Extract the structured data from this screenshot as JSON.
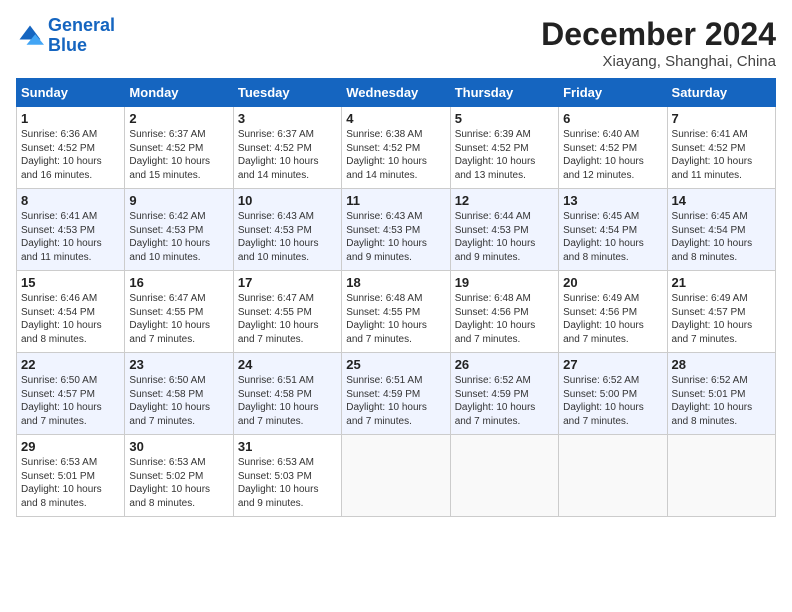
{
  "header": {
    "logo_general": "General",
    "logo_blue": "Blue",
    "month_title": "December 2024",
    "location": "Xiayang, Shanghai, China"
  },
  "weekdays": [
    "Sunday",
    "Monday",
    "Tuesday",
    "Wednesday",
    "Thursday",
    "Friday",
    "Saturday"
  ],
  "weeks": [
    [
      {
        "day": "1",
        "info": "Sunrise: 6:36 AM\nSunset: 4:52 PM\nDaylight: 10 hours\nand 16 minutes."
      },
      {
        "day": "2",
        "info": "Sunrise: 6:37 AM\nSunset: 4:52 PM\nDaylight: 10 hours\nand 15 minutes."
      },
      {
        "day": "3",
        "info": "Sunrise: 6:37 AM\nSunset: 4:52 PM\nDaylight: 10 hours\nand 14 minutes."
      },
      {
        "day": "4",
        "info": "Sunrise: 6:38 AM\nSunset: 4:52 PM\nDaylight: 10 hours\nand 14 minutes."
      },
      {
        "day": "5",
        "info": "Sunrise: 6:39 AM\nSunset: 4:52 PM\nDaylight: 10 hours\nand 13 minutes."
      },
      {
        "day": "6",
        "info": "Sunrise: 6:40 AM\nSunset: 4:52 PM\nDaylight: 10 hours\nand 12 minutes."
      },
      {
        "day": "7",
        "info": "Sunrise: 6:41 AM\nSunset: 4:52 PM\nDaylight: 10 hours\nand 11 minutes."
      }
    ],
    [
      {
        "day": "8",
        "info": "Sunrise: 6:41 AM\nSunset: 4:53 PM\nDaylight: 10 hours\nand 11 minutes."
      },
      {
        "day": "9",
        "info": "Sunrise: 6:42 AM\nSunset: 4:53 PM\nDaylight: 10 hours\nand 10 minutes."
      },
      {
        "day": "10",
        "info": "Sunrise: 6:43 AM\nSunset: 4:53 PM\nDaylight: 10 hours\nand 10 minutes."
      },
      {
        "day": "11",
        "info": "Sunrise: 6:43 AM\nSunset: 4:53 PM\nDaylight: 10 hours\nand 9 minutes."
      },
      {
        "day": "12",
        "info": "Sunrise: 6:44 AM\nSunset: 4:53 PM\nDaylight: 10 hours\nand 9 minutes."
      },
      {
        "day": "13",
        "info": "Sunrise: 6:45 AM\nSunset: 4:54 PM\nDaylight: 10 hours\nand 8 minutes."
      },
      {
        "day": "14",
        "info": "Sunrise: 6:45 AM\nSunset: 4:54 PM\nDaylight: 10 hours\nand 8 minutes."
      }
    ],
    [
      {
        "day": "15",
        "info": "Sunrise: 6:46 AM\nSunset: 4:54 PM\nDaylight: 10 hours\nand 8 minutes."
      },
      {
        "day": "16",
        "info": "Sunrise: 6:47 AM\nSunset: 4:55 PM\nDaylight: 10 hours\nand 7 minutes."
      },
      {
        "day": "17",
        "info": "Sunrise: 6:47 AM\nSunset: 4:55 PM\nDaylight: 10 hours\nand 7 minutes."
      },
      {
        "day": "18",
        "info": "Sunrise: 6:48 AM\nSunset: 4:55 PM\nDaylight: 10 hours\nand 7 minutes."
      },
      {
        "day": "19",
        "info": "Sunrise: 6:48 AM\nSunset: 4:56 PM\nDaylight: 10 hours\nand 7 minutes."
      },
      {
        "day": "20",
        "info": "Sunrise: 6:49 AM\nSunset: 4:56 PM\nDaylight: 10 hours\nand 7 minutes."
      },
      {
        "day": "21",
        "info": "Sunrise: 6:49 AM\nSunset: 4:57 PM\nDaylight: 10 hours\nand 7 minutes."
      }
    ],
    [
      {
        "day": "22",
        "info": "Sunrise: 6:50 AM\nSunset: 4:57 PM\nDaylight: 10 hours\nand 7 minutes."
      },
      {
        "day": "23",
        "info": "Sunrise: 6:50 AM\nSunset: 4:58 PM\nDaylight: 10 hours\nand 7 minutes."
      },
      {
        "day": "24",
        "info": "Sunrise: 6:51 AM\nSunset: 4:58 PM\nDaylight: 10 hours\nand 7 minutes."
      },
      {
        "day": "25",
        "info": "Sunrise: 6:51 AM\nSunset: 4:59 PM\nDaylight: 10 hours\nand 7 minutes."
      },
      {
        "day": "26",
        "info": "Sunrise: 6:52 AM\nSunset: 4:59 PM\nDaylight: 10 hours\nand 7 minutes."
      },
      {
        "day": "27",
        "info": "Sunrise: 6:52 AM\nSunset: 5:00 PM\nDaylight: 10 hours\nand 7 minutes."
      },
      {
        "day": "28",
        "info": "Sunrise: 6:52 AM\nSunset: 5:01 PM\nDaylight: 10 hours\nand 8 minutes."
      }
    ],
    [
      {
        "day": "29",
        "info": "Sunrise: 6:53 AM\nSunset: 5:01 PM\nDaylight: 10 hours\nand 8 minutes."
      },
      {
        "day": "30",
        "info": "Sunrise: 6:53 AM\nSunset: 5:02 PM\nDaylight: 10 hours\nand 8 minutes."
      },
      {
        "day": "31",
        "info": "Sunrise: 6:53 AM\nSunset: 5:03 PM\nDaylight: 10 hours\nand 9 minutes."
      },
      {
        "day": "",
        "info": ""
      },
      {
        "day": "",
        "info": ""
      },
      {
        "day": "",
        "info": ""
      },
      {
        "day": "",
        "info": ""
      }
    ]
  ]
}
